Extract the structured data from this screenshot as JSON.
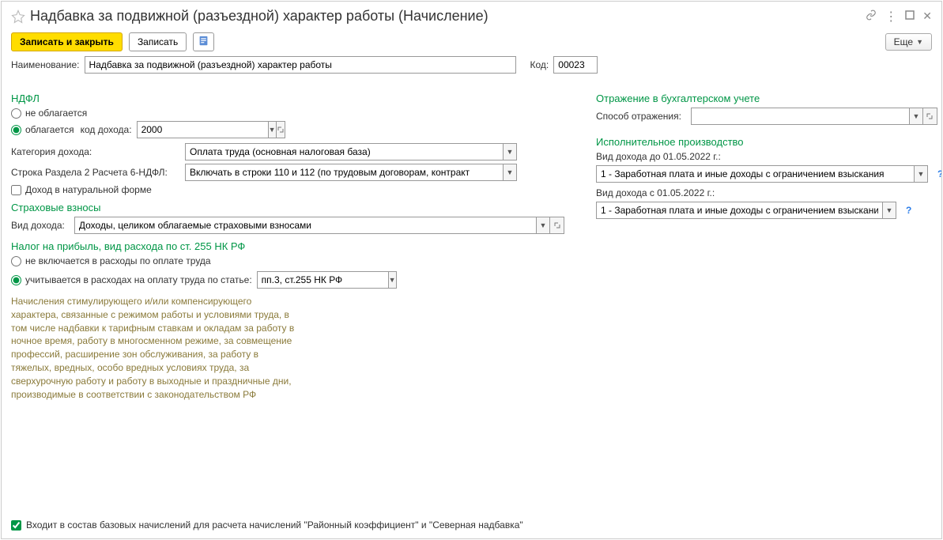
{
  "title": "Надбавка за подвижной (разъездной) характер работы (Начисление)",
  "toolbar": {
    "save_close": "Записать и закрыть",
    "save": "Записать",
    "more": "Еще"
  },
  "fields": {
    "name_label": "Наименование:",
    "name_value": "Надбавка за подвижной (разъездной) характер работы",
    "code_label": "Код:",
    "code_value": "00023"
  },
  "ndfl": {
    "title": "НДФЛ",
    "not_taxed": "не облагается",
    "taxed": "облагается",
    "income_code_label": "код дохода:",
    "income_code_value": "2000",
    "category_label": "Категория дохода:",
    "category_value": "Оплата труда (основная налоговая база)",
    "section2_label": "Строка Раздела 2 Расчета 6-НДФЛ:",
    "section2_value": "Включать в строки 110 и 112 (по трудовым договорам, контракт",
    "natural_form": "Доход в натуральной форме"
  },
  "insurance": {
    "title": "Страховые взносы",
    "income_type_label": "Вид дохода:",
    "income_type_value": "Доходы, целиком облагаемые страховыми взносами"
  },
  "profit_tax": {
    "title": "Налог на прибыль, вид расхода по ст. 255 НК РФ",
    "not_included": "не включается в расходы по оплате труда",
    "included": "учитывается в расходах на оплату труда по статье:",
    "article_value": "пп.3, ст.255 НК РФ",
    "description": "Начисления стимулирующего и/или компенсирующего характера, связанные с режимом работы и условиями труда, в том числе надбавки к тарифным ставкам и окладам за работу в ночное время, работу в многосменном режиме, за совмещение профессий, расширение зон обслуживания, за работу в тяжелых, вредных, особо вредных условиях труда, за сверхурочную работу и работу в выходные и праздничные дни, производимые в соответствии с законодательством РФ"
  },
  "accounting": {
    "title": "Отражение в бухгалтерском учете",
    "method_label": "Способ отражения:",
    "method_value": ""
  },
  "enforcement": {
    "title": "Исполнительное производство",
    "before_label": "Вид дохода до 01.05.2022 г.:",
    "before_value": "1 - Заработная плата и иные доходы с ограничением взыскания",
    "after_label": "Вид дохода с 01.05.2022 г.:",
    "after_value": "1 - Заработная плата и иные доходы с ограничением взыскани"
  },
  "footer": {
    "base_accrual": "Входит в состав базовых начислений для расчета начислений \"Районный коэффициент\" и \"Северная надбавка\""
  }
}
